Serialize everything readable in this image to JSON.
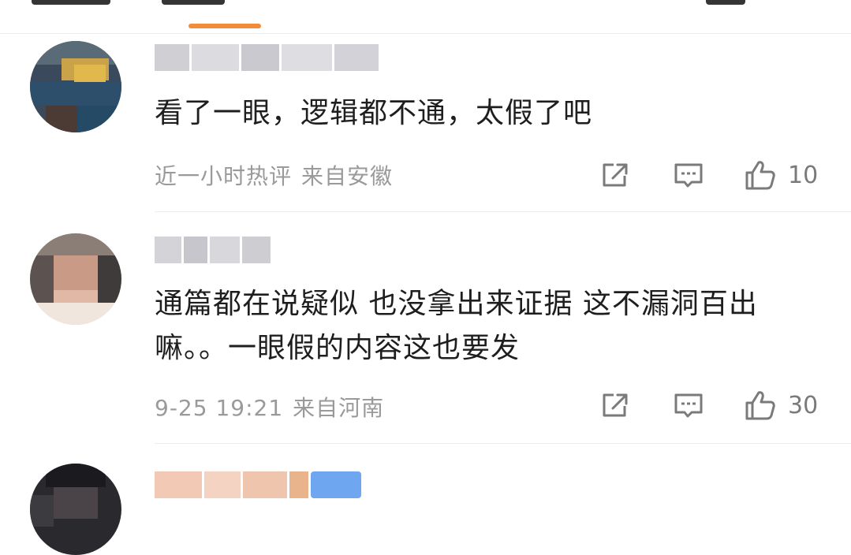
{
  "header": {
    "tabs": [
      {
        "label": "",
        "active": false
      },
      {
        "label": "",
        "active": true
      },
      {
        "label": "",
        "active": false
      }
    ],
    "active_underline_color": "#f08c3a"
  },
  "comments": [
    {
      "text": "看了一眼，逻辑都不通，太假了吧",
      "time": "近一小时热评",
      "location": "来自安徽",
      "likes": "10",
      "avatar_blurred": true,
      "username_blurred": true
    },
    {
      "text": "通篇都在说疑似 也没拿出来证据 这不漏洞百出嘛。。一眼假的内容这也要发",
      "time": "9-25 19:21",
      "location": "来自河南",
      "likes": "30",
      "avatar_blurred": true,
      "username_blurred": true
    },
    {
      "text": "",
      "avatar_blurred": true,
      "username_blurred": true,
      "has_badge": true
    }
  ],
  "icons": {
    "share": "share-icon",
    "reply": "comment-icon",
    "like": "thumbs-up-icon"
  },
  "colors": {
    "meta_text": "#9a9a9a",
    "icon": "#7a7a7a",
    "badge": "#6fa6f0"
  }
}
